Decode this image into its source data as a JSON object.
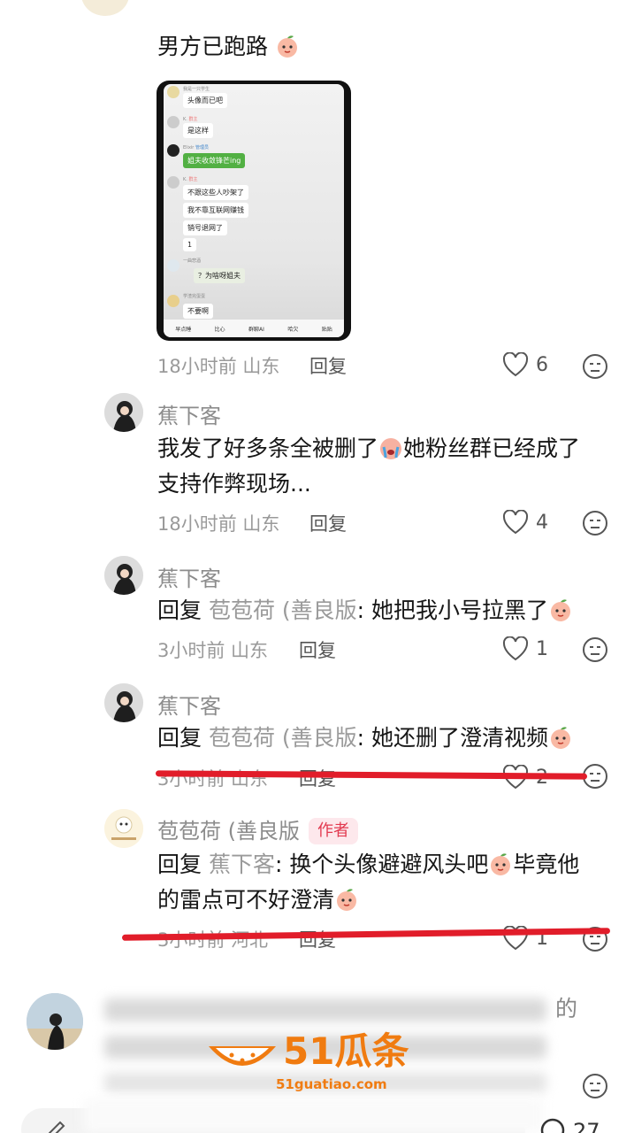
{
  "top_reply": {
    "text": "男方已跑路",
    "meta": "18小时前 山东",
    "reply": "回复",
    "likes": "6"
  },
  "chat_screenshot": {
    "messages": [
      {
        "name": "我是一只学生",
        "text": "头像而已吧"
      },
      {
        "name": "K.",
        "tag": "群主",
        "text": "是这样"
      },
      {
        "name": "Elixir",
        "tag": "管理员",
        "text": "姐夫收敛锋芒ing"
      },
      {
        "name": "K.",
        "tag": "群主",
        "text": "不跟这些人吵架了"
      },
      {
        "name": "",
        "text": "我不靠互联网赚钱"
      },
      {
        "name": "",
        "text": "销号退网了"
      },
      {
        "name": "",
        "text": "1"
      },
      {
        "name": "一曲悲酒",
        "text": "？为啥呀姐夫"
      },
      {
        "name": "学渣完蛋蛋",
        "text": "不要啊"
      }
    ],
    "bar": [
      "早点睡",
      "比心",
      "群聊AI",
      "哈欠",
      "贴贴"
    ]
  },
  "comments": [
    {
      "user": "蕉下客",
      "text_line1": "我发了好多条全被删了",
      "text_line1b": "她粉丝群已经成了",
      "text_line2": "支持作弊现场...",
      "meta": "18小时前 山东",
      "reply": "回复",
      "likes": "4"
    },
    {
      "user": "蕉下客",
      "reply_prefix": "回复",
      "reply_to": "苞苞荷 (善良版",
      "text": ": 她把我小号拉黑了",
      "meta": "3小时前 山东",
      "reply": "回复",
      "likes": "1"
    },
    {
      "user": "蕉下客",
      "reply_prefix": "回复",
      "reply_to": "苞苞荷 (善良版",
      "text": ": 她还删了澄清视频",
      "meta": "3小时前 山东",
      "reply": "回复",
      "likes": "2"
    },
    {
      "user": "苞苞荷 (善良版",
      "badge": "作者",
      "reply_prefix": "回复",
      "reply_to": "蕉下客",
      "text_a": ": 换个头像避避风头吧",
      "text_b": "毕竟他",
      "text_line2": "的雷点可不好澄清",
      "meta": "3小时前 河北",
      "reply": "回复",
      "likes": "1"
    }
  ],
  "blurred_comment": {
    "tail": "的"
  },
  "watermark": {
    "brand": "51瓜条",
    "url": "51guatiao.com"
  },
  "bottom_bar": {
    "count": "27"
  },
  "colors": {
    "accent_red": "#e11d2a",
    "author_badge": "#e2394f",
    "watermark_orange": "#f07b10"
  }
}
